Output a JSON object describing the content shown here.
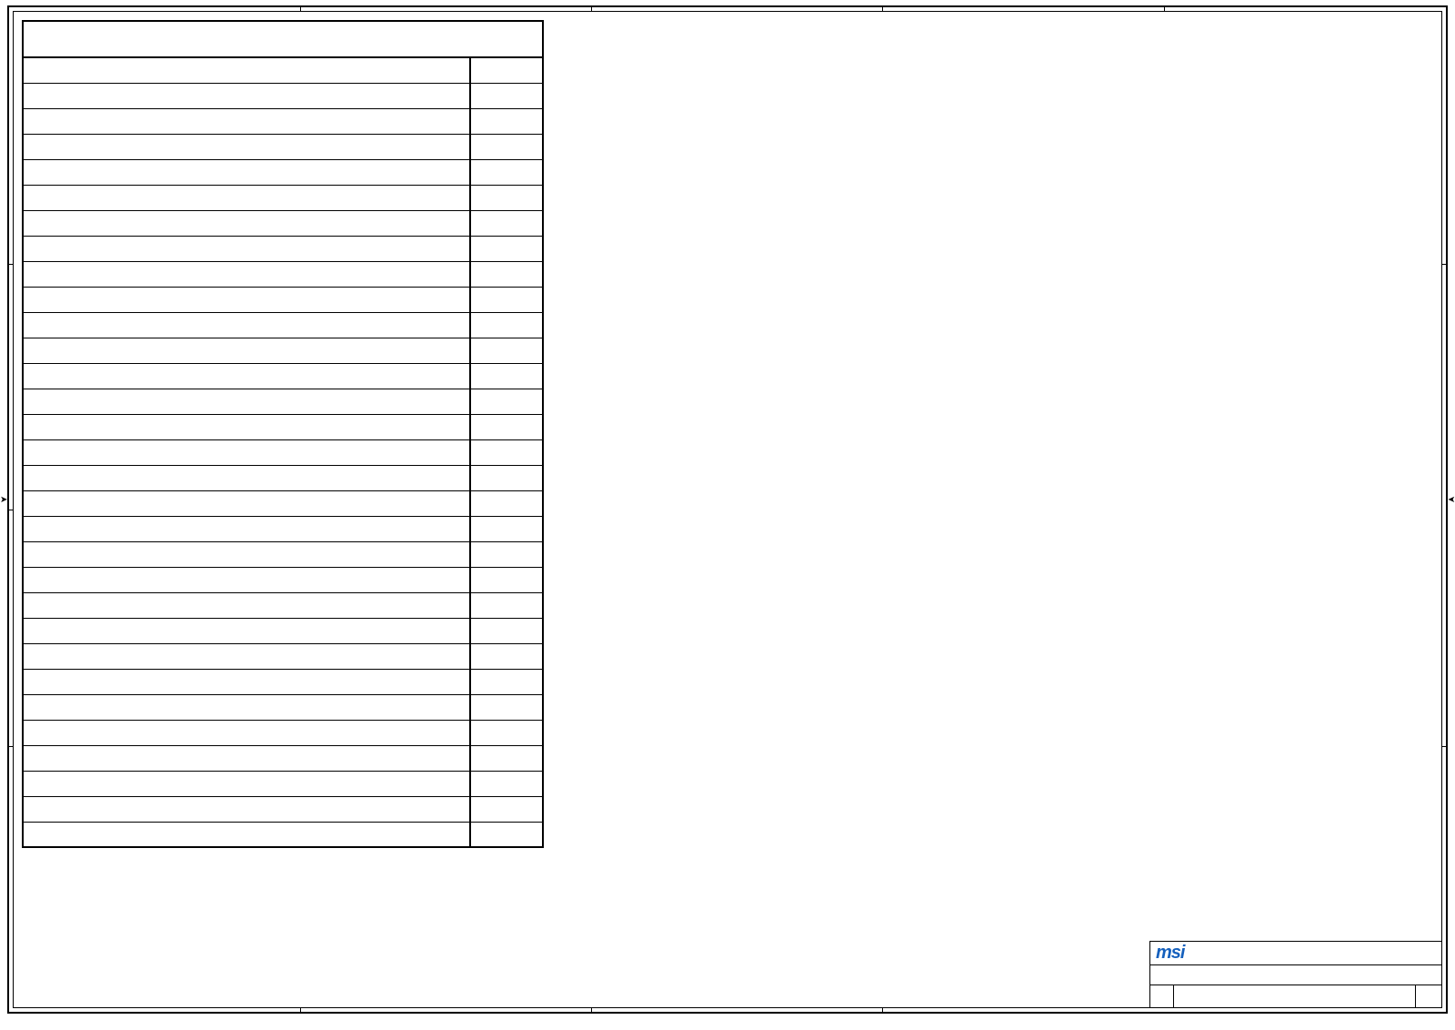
{
  "frame": {
    "top_ticks_x": [
      330,
      650,
      970,
      1280
    ],
    "bottom_ticks_x": [
      330,
      650,
      970
    ],
    "left_ticks_y": [
      290,
      560,
      820
    ],
    "right_ticks_y": [
      290,
      820
    ]
  },
  "index_table": {
    "header": "",
    "rows": [
      {
        "desc": "",
        "page": ""
      },
      {
        "desc": "",
        "page": ""
      },
      {
        "desc": "",
        "page": ""
      },
      {
        "desc": "",
        "page": ""
      },
      {
        "desc": "",
        "page": ""
      },
      {
        "desc": "",
        "page": ""
      },
      {
        "desc": "",
        "page": ""
      },
      {
        "desc": "",
        "page": ""
      },
      {
        "desc": "",
        "page": ""
      },
      {
        "desc": "",
        "page": ""
      },
      {
        "desc": "",
        "page": ""
      },
      {
        "desc": "",
        "page": ""
      },
      {
        "desc": "",
        "page": ""
      },
      {
        "desc": "",
        "page": ""
      },
      {
        "desc": "",
        "page": ""
      },
      {
        "desc": "",
        "page": ""
      },
      {
        "desc": "",
        "page": ""
      },
      {
        "desc": "",
        "page": ""
      },
      {
        "desc": "",
        "page": ""
      },
      {
        "desc": "",
        "page": ""
      },
      {
        "desc": "",
        "page": ""
      },
      {
        "desc": "",
        "page": ""
      },
      {
        "desc": "",
        "page": ""
      },
      {
        "desc": "",
        "page": ""
      },
      {
        "desc": "",
        "page": ""
      },
      {
        "desc": "",
        "page": ""
      },
      {
        "desc": "",
        "page": ""
      },
      {
        "desc": "",
        "page": ""
      },
      {
        "desc": "",
        "page": ""
      },
      {
        "desc": "",
        "page": ""
      },
      {
        "desc": "",
        "page": ""
      }
    ]
  },
  "title_block": {
    "logo_text": "msi",
    "row2": "",
    "row3_a": "",
    "row3_b": "",
    "row3_c": ""
  }
}
